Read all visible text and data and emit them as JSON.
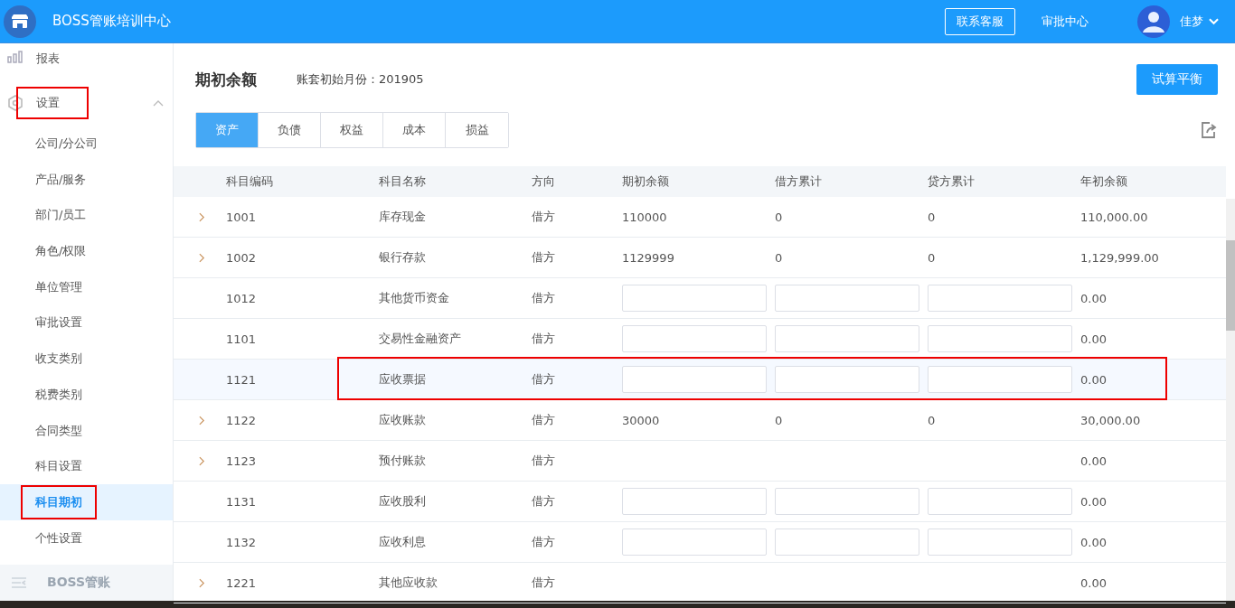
{
  "header": {
    "title": "BOSS管账培训中心",
    "contact_button": "联系客服",
    "approval_link": "审批中心",
    "user_name": "佳梦"
  },
  "sidebar": {
    "items": [
      {
        "label": "报表",
        "kind": "section",
        "highlighted": false
      },
      {
        "label": "设置",
        "kind": "section",
        "expanded": true,
        "highlighted": true
      },
      {
        "label": "公司/分公司",
        "kind": "sub",
        "selected": false,
        "highlighted": false
      },
      {
        "label": "产品/服务",
        "kind": "sub",
        "selected": false,
        "highlighted": false
      },
      {
        "label": "部门/员工",
        "kind": "sub",
        "selected": false,
        "highlighted": false
      },
      {
        "label": "角色/权限",
        "kind": "sub",
        "selected": false,
        "highlighted": false
      },
      {
        "label": "单位管理",
        "kind": "sub",
        "selected": false,
        "highlighted": false
      },
      {
        "label": "审批设置",
        "kind": "sub",
        "selected": false,
        "highlighted": false
      },
      {
        "label": "收支类别",
        "kind": "sub",
        "selected": false,
        "highlighted": false
      },
      {
        "label": "税费类别",
        "kind": "sub",
        "selected": false,
        "highlighted": false
      },
      {
        "label": "合同类型",
        "kind": "sub",
        "selected": false,
        "highlighted": false
      },
      {
        "label": "科目设置",
        "kind": "sub",
        "selected": false,
        "highlighted": false
      },
      {
        "label": "科目期初",
        "kind": "sub",
        "selected": true,
        "highlighted": true
      },
      {
        "label": "个性设置",
        "kind": "sub",
        "selected": false,
        "highlighted": false
      }
    ],
    "footer": "BOSS管账"
  },
  "page": {
    "title": "期初余额",
    "start_month": "账套初始月份：201905",
    "trial_balance_button": "试算平衡"
  },
  "tabs": [
    {
      "label": "资产",
      "selected": true
    },
    {
      "label": "负债",
      "selected": false
    },
    {
      "label": "权益",
      "selected": false
    },
    {
      "label": "成本",
      "selected": false
    },
    {
      "label": "损益",
      "selected": false
    }
  ],
  "table": {
    "columns": [
      "科目编码",
      "科目名称",
      "方向",
      "期初余额",
      "借方累计",
      "贷方累计",
      "年初余额"
    ],
    "rows": [
      {
        "code": "1001",
        "name": "库存现金",
        "direction": "借方",
        "expandable": true,
        "editable": false,
        "opening": "110000",
        "debit": "0",
        "credit": "0",
        "year_start": "110,000.00",
        "highlighted": false
      },
      {
        "code": "1002",
        "name": "银行存款",
        "direction": "借方",
        "expandable": true,
        "editable": false,
        "opening": "1129999",
        "debit": "0",
        "credit": "0",
        "year_start": "1,129,999.00",
        "highlighted": false
      },
      {
        "code": "1012",
        "name": "其他货币资金",
        "direction": "借方",
        "expandable": false,
        "editable": true,
        "year_start": "0.00",
        "highlighted": false
      },
      {
        "code": "1101",
        "name": "交易性金融资产",
        "direction": "借方",
        "expandable": false,
        "editable": true,
        "year_start": "0.00",
        "highlighted": false
      },
      {
        "code": "1121",
        "name": "应收票据",
        "direction": "借方",
        "expandable": false,
        "editable": true,
        "year_start": "0.00",
        "highlighted": true
      },
      {
        "code": "1122",
        "name": "应收账款",
        "direction": "借方",
        "expandable": true,
        "editable": false,
        "opening": "30000",
        "debit": "0",
        "credit": "0",
        "year_start": "30,000.00",
        "highlighted": false
      },
      {
        "code": "1123",
        "name": "预付账款",
        "direction": "借方",
        "expandable": true,
        "editable": false,
        "year_start": "0.00",
        "highlighted": false
      },
      {
        "code": "1131",
        "name": "应收股利",
        "direction": "借方",
        "expandable": false,
        "editable": true,
        "year_start": "0.00",
        "highlighted": false
      },
      {
        "code": "1132",
        "name": "应收利息",
        "direction": "借方",
        "expandable": false,
        "editable": true,
        "year_start": "0.00",
        "highlighted": false
      },
      {
        "code": "1221",
        "name": "其他应收款",
        "direction": "借方",
        "expandable": true,
        "editable": false,
        "year_start": "0.00",
        "highlighted": false
      }
    ]
  }
}
